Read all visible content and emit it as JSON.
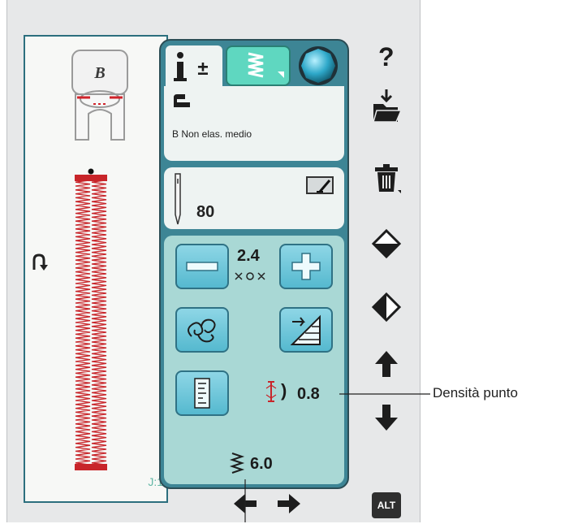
{
  "left_panel": {
    "presser_foot_letter": "B",
    "pattern_ref": "J:1"
  },
  "settings": {
    "tabs": [
      {
        "icon": "info-plus-minus-icon",
        "label": "i±"
      },
      {
        "icon": "stitch-zigzag-icon"
      },
      {
        "icon": "sphere-icon"
      }
    ],
    "foot_label": "B Non elas. medio",
    "needle_size": "80",
    "stitch_length": "2.4",
    "density": "0.8",
    "stitch_width": "6.0"
  },
  "toolbar": {
    "help_label": "?",
    "alt_label": "ALT"
  },
  "callout": {
    "density_label": "Densità punto"
  },
  "colors": {
    "panel_teal": "#3d8595",
    "button_blue": "#6ac6dc",
    "stitch_red": "#c8252a",
    "tab_green": "#5fd7c0"
  }
}
